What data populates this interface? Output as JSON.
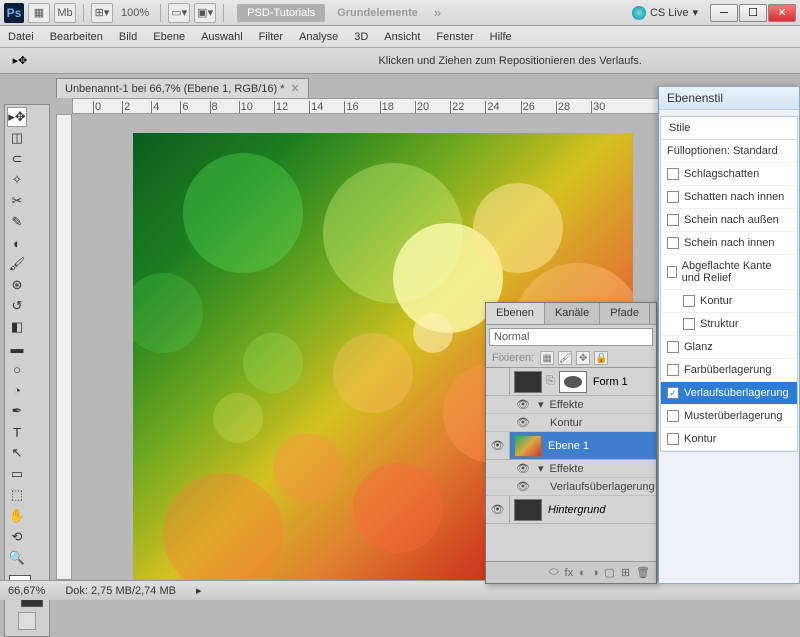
{
  "topbar": {
    "zoom": "100%",
    "psd_tutorials": "PSD-Tutorials",
    "grundelemente": "Grundelemente",
    "cslive": "CS Live"
  },
  "menu": [
    "Datei",
    "Bearbeiten",
    "Bild",
    "Ebene",
    "Auswahl",
    "Filter",
    "Analyse",
    "3D",
    "Ansicht",
    "Fenster",
    "Hilfe"
  ],
  "optbar": {
    "hint": "Klicken und Ziehen zum Repositionieren des Verlaufs."
  },
  "doc": {
    "tab_title": "Unbenannt-1 bei 66,7% (Ebene 1, RGB/16) *"
  },
  "ruler_h": [
    "0",
    "2",
    "4",
    "6",
    "8",
    "10",
    "12",
    "14",
    "16",
    "18",
    "20",
    "22",
    "24",
    "26",
    "28",
    "30"
  ],
  "status": {
    "zoom": "66,67%",
    "doc": "Dok: 2,75 MB/2,74 MB"
  },
  "layers_panel": {
    "tabs": [
      "Ebenen",
      "Kanäle",
      "Pfade"
    ],
    "blend": "Normal",
    "lock_label": "Fixieren:",
    "items": [
      {
        "name": "Form 1",
        "fx_label": "Effekte",
        "fx_sub": "Kontur"
      },
      {
        "name": "Ebene 1",
        "fx_label": "Effekte",
        "fx_sub": "Verlaufsüberlagerung"
      },
      {
        "name": "Hintergrund"
      }
    ]
  },
  "styles_panel": {
    "title": "Ebenenstil",
    "head": "Stile",
    "fill_opts": "Fülloptionen: Standard",
    "items": [
      {
        "label": "Schlagschatten"
      },
      {
        "label": "Schatten nach innen"
      },
      {
        "label": "Schein nach außen"
      },
      {
        "label": "Schein nach innen"
      },
      {
        "label": "Abgeflachte Kante und Relief"
      },
      {
        "label": "Kontur",
        "indent": true
      },
      {
        "label": "Struktur",
        "indent": true
      },
      {
        "label": "Glanz"
      },
      {
        "label": "Farbüberlagerung"
      },
      {
        "label": "Verlaufsüberlagerung",
        "checked": true,
        "sel": true
      },
      {
        "label": "Musterüberlagerung"
      },
      {
        "label": "Kontur"
      }
    ]
  }
}
